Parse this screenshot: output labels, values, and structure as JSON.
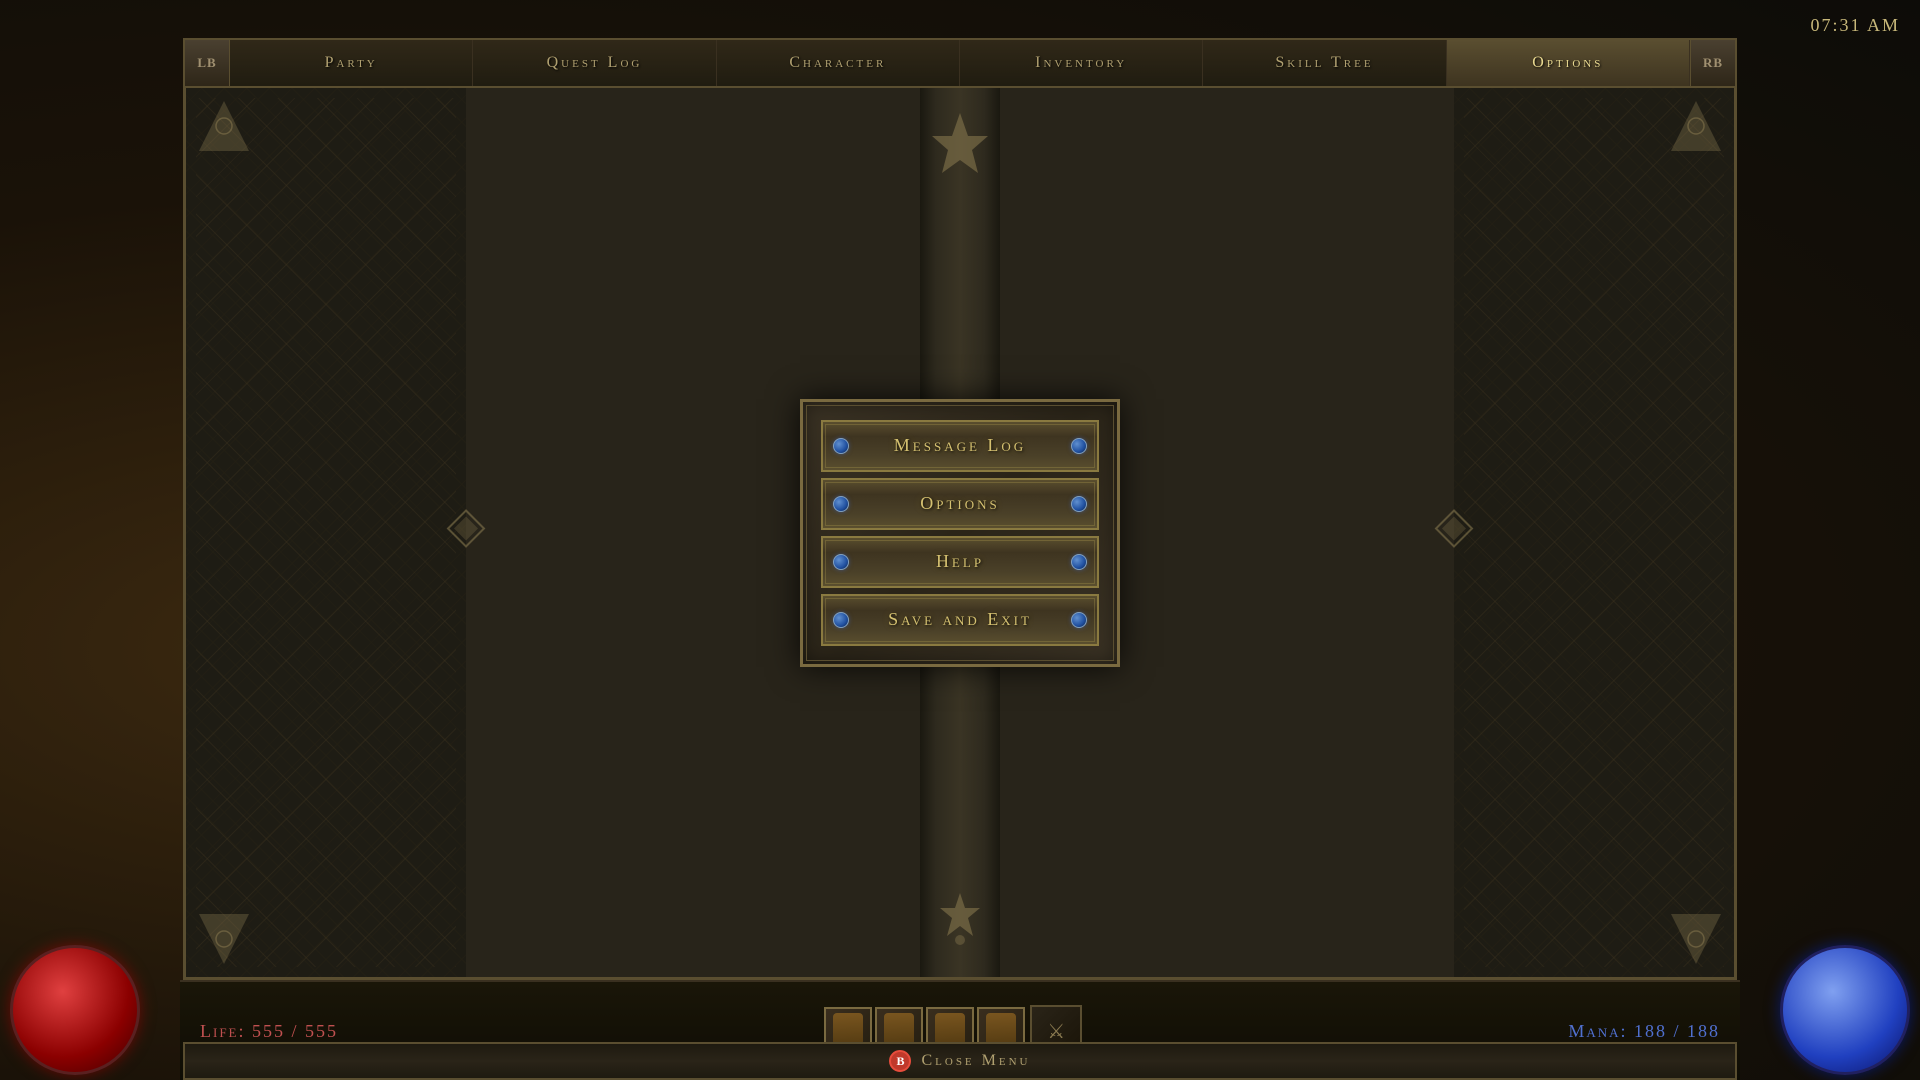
{
  "clock": "07:31 AM",
  "tabs": {
    "lb": "LB",
    "rb": "RB",
    "items": [
      {
        "id": "party",
        "label": "Party",
        "active": false
      },
      {
        "id": "quest-log",
        "label": "Quest Log",
        "active": false
      },
      {
        "id": "character",
        "label": "Character",
        "active": false
      },
      {
        "id": "inventory",
        "label": "Inventory",
        "active": false
      },
      {
        "id": "skill-tree",
        "label": "Skill Tree",
        "active": false
      },
      {
        "id": "options",
        "label": "Options",
        "active": true
      }
    ]
  },
  "dialog": {
    "buttons": [
      {
        "id": "message-log",
        "label": "Message Log"
      },
      {
        "id": "options",
        "label": "Options"
      },
      {
        "id": "help",
        "label": "Help"
      },
      {
        "id": "save-and-exit",
        "label": "Save and Exit"
      }
    ]
  },
  "bottom_bar": {
    "b_label": "B",
    "close_label": "Close Menu"
  },
  "hud": {
    "life_label": "Life:",
    "life_current": "555",
    "life_max": "555",
    "life_separator": "/",
    "mana_label": "Mana:",
    "mana_current": "188",
    "mana_max": "188",
    "mana_separator": "/"
  }
}
